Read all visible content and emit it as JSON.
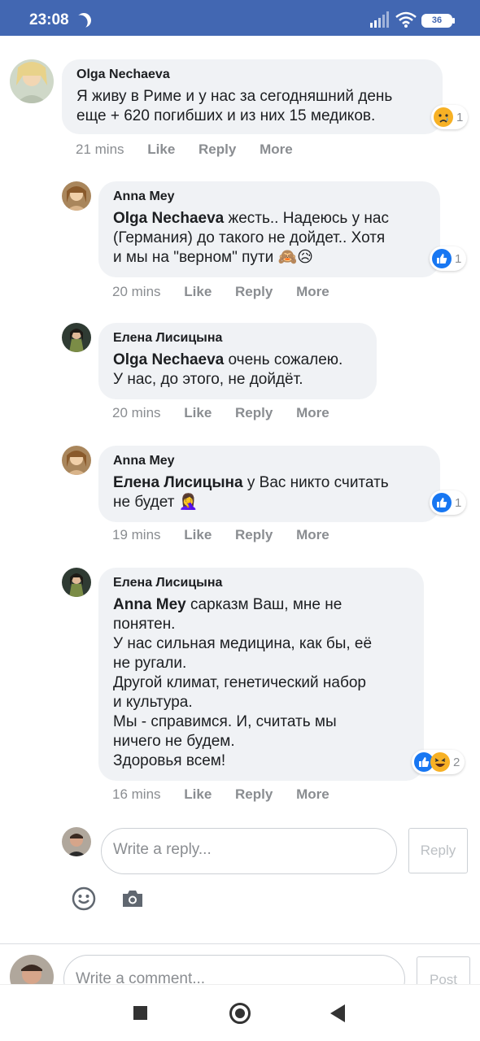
{
  "status_bar": {
    "time": "23:08",
    "battery": "36",
    "colors": {
      "background": "#4267b2"
    }
  },
  "actions": {
    "like": "Like",
    "reply": "Reply",
    "more": "More"
  },
  "comments": [
    {
      "author": "Olga Nechaeva",
      "mention": "",
      "text": "Я живу в Риме и у нас за сегодняшний день\nеще + 620 погибших и из них 15 медиков.",
      "emoji": "",
      "time": "21 mins",
      "reaction_count": "1",
      "reaction_icons": [
        "sad-reaction"
      ]
    },
    {
      "author": "Anna Mey",
      "mention": "Olga Nechaeva",
      "text": " жесть.. Надеюсь у нас\n(Германия) до такого не дойдет.. Хотя\nи мы на \"верном\" пути ",
      "emoji": "🙈😥",
      "time": "20 mins",
      "reaction_count": "1",
      "reaction_icons": [
        "like-reaction"
      ]
    },
    {
      "author": "Елена Лисицына",
      "mention": "Olga Nechaeva",
      "text": " очень сожалею.\nУ нас, до этого, не дойдёт.",
      "emoji": "",
      "time": "20 mins",
      "reaction_count": "",
      "reaction_icons": []
    },
    {
      "author": "Anna Mey",
      "mention": "Елена Лисицына",
      "text": " у Вас никто считать\nне будет ",
      "emoji": "🤦‍♀️",
      "time": "19 mins",
      "reaction_count": "1",
      "reaction_icons": [
        "like-reaction"
      ]
    },
    {
      "author": "Елена Лисицына",
      "mention": "Anna Mey",
      "text": " сарказм Ваш, мне не\nпонятен.\nУ нас сильная медицина, как бы, её\nне ругали.\nДругой климат, генетический набор\nи культура.\nМы - справимся. И, считать мы\nничего не будем.\nЗдоровья всем!",
      "emoji": "",
      "time": "16 mins",
      "reaction_count": "2",
      "reaction_icons": [
        "like-reaction",
        "haha-reaction"
      ]
    }
  ],
  "reply_box": {
    "placeholder": "Write a reply...",
    "button": "Reply"
  },
  "comment_box": {
    "placeholder": "Write a comment...",
    "button": "Post"
  },
  "icons": [
    "smiley-icon",
    "camera-icon"
  ]
}
